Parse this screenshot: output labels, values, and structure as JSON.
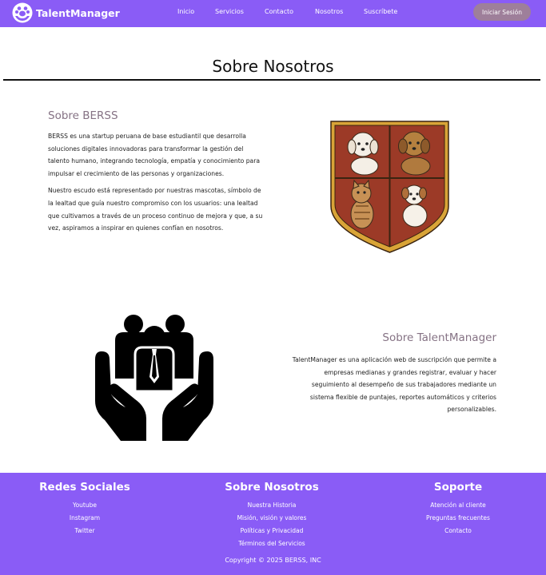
{
  "header": {
    "brand_name": "TalentManager",
    "nav": [
      "Inicio",
      "Servicios",
      "Contacto",
      "Nosotros",
      "Suscríbete"
    ],
    "login_label": "Iniciar Sesión"
  },
  "page": {
    "title": "Sobre Nosotros"
  },
  "berss": {
    "heading": "Sobre BERSS",
    "paragraph1": "BERSS es una startup peruana de base estudiantil que desarrolla soluciones digitales innovadoras para transformar la gestión del talento humano, integrando tecnología, empatía y conocimiento para impulsar el crecimiento de las personas y organizaciones.",
    "paragraph2": "Nuestro escudo está representado por nuestras mascotas, símbolo de la lealtad que guía nuestro compromiso con los usuarios: una lealtad que cultivamos a través de un proceso continuo de mejora y que, a su vez, aspiramos a inspirar en quienes confían en nosotros."
  },
  "talentmanager": {
    "heading": "Sobre TalentManager",
    "paragraph": "TalentManager es una aplicación web de suscripción que permite a empresas medianas y grandes registrar, evaluar y hacer seguimiento al desempeño de sus trabajadores mediante un sistema flexible de puntajes, reportes automáticos y criterios personalizables."
  },
  "footer": {
    "social": {
      "title": "Redes Sociales",
      "links": [
        "Youtube",
        "Instagram",
        "Twitter"
      ]
    },
    "about": {
      "title": "Sobre Nosotros",
      "links": [
        "Nuestra Historia",
        "Misión, visión y valores",
        "Políticas y Privacidad",
        "Términos del Servicios"
      ]
    },
    "support": {
      "title": "Soporte",
      "links": [
        "Atención al cliente",
        "Preguntas frecuentes",
        "Contacto"
      ]
    },
    "copyright": "Copyright © 2025 BERSS, INC"
  },
  "colors": {
    "brand_purple": "#8a5cf6",
    "login_button": "#9e7f9a",
    "section_heading": "#857284",
    "shield_red": "#9c3a27",
    "shield_gold": "#d9a437"
  },
  "icons": {
    "logo": "paw-hand-logo-icon",
    "crest": "mascots-crest-image",
    "team": "hands-holding-people-icon"
  }
}
